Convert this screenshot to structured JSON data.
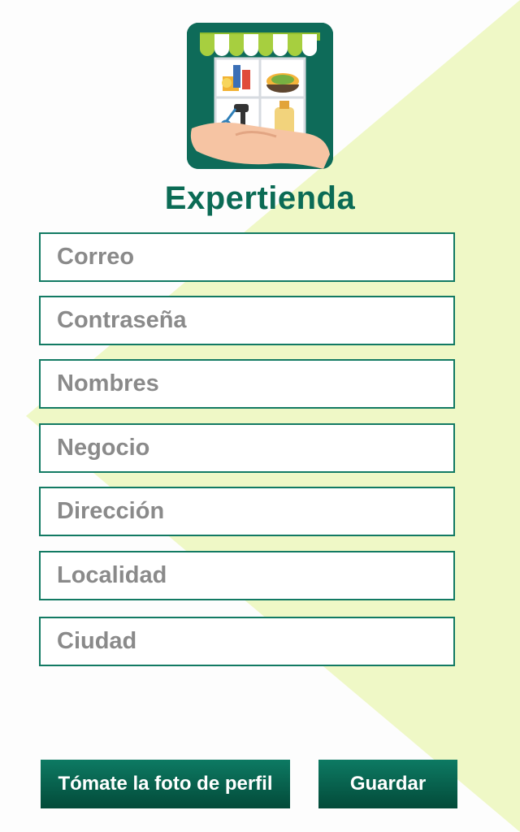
{
  "app": {
    "title": "Expertienda",
    "logo_icon": "store-with-hand-icon"
  },
  "colors": {
    "brand_green": "#0b6b55",
    "field_border": "#127a63",
    "background_accent": "#eff8c6",
    "button_top": "#0d7a63",
    "button_bottom": "#034a39"
  },
  "form": {
    "fields": [
      {
        "placeholder": "Correo",
        "value": ""
      },
      {
        "placeholder": "Contraseña",
        "value": ""
      },
      {
        "placeholder": "Nombres",
        "value": ""
      },
      {
        "placeholder": "Negocio",
        "value": ""
      },
      {
        "placeholder": "Dirección",
        "value": ""
      },
      {
        "placeholder": "Localidad",
        "value": ""
      },
      {
        "placeholder": "Ciudad",
        "value": ""
      }
    ]
  },
  "buttons": {
    "photo_label": "Tómate la foto de perfil",
    "save_label": "Guardar"
  }
}
